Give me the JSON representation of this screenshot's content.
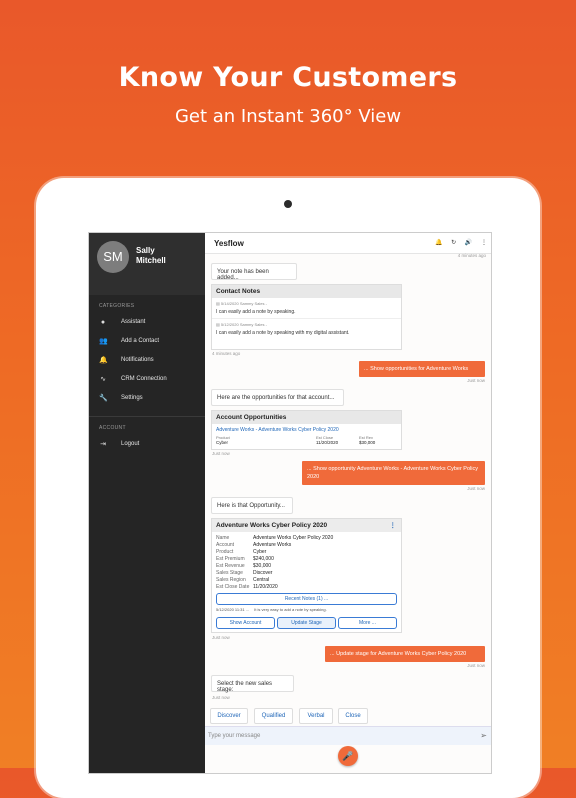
{
  "promo": {
    "headline": "Know Your Customers",
    "subline": "Get an Instant 360° View"
  },
  "colors": {
    "accent": "#f06a3a",
    "sidebar": "#252525",
    "link": "#1f66b8"
  },
  "sidebar": {
    "avatar": "SM",
    "user_name": "Sally\nMitchell",
    "categories_label": "CATEGORIES",
    "items": [
      {
        "label": "Assistant",
        "icon": "chat-icon"
      },
      {
        "label": "Add a Contact",
        "icon": "add-user-icon"
      },
      {
        "label": "Notifications",
        "icon": "bell-icon"
      },
      {
        "label": "CRM Connection",
        "icon": "pulse-icon"
      },
      {
        "label": "Settings",
        "icon": "wrench-icon"
      }
    ],
    "account_label": "ACCOUNT",
    "logout": {
      "label": "Logout",
      "icon": "logout-icon"
    }
  },
  "topbar": {
    "title": "Yesflow",
    "icons": [
      "bell-icon",
      "refresh-icon",
      "volume-icon",
      "more-vertical-icon"
    ]
  },
  "chat": {
    "top_ts": "4 minutes ago",
    "note_added": "Your note has been added...",
    "contact_notes": {
      "title": "Contact Notes",
      "notes": [
        {
          "meta": "5/14/2020  Sammy Sales -",
          "text": "I can easily add a note by speaking."
        },
        {
          "meta": "5/12/2020  Sammy Sales -",
          "text": "I can easily add a note by speaking with my digital assistant."
        }
      ],
      "ts": "4 minutes ago"
    },
    "user_msg_1": "... Show opportunities for Adventure Works",
    "user_ts_1": "Just now",
    "opps_intro": "Here are the opportunities for that account...",
    "account_opps": {
      "title": "Account Opportunities",
      "link": "Adventure Works - Adventure Works Cyber Policy 2020",
      "headers": [
        "Product",
        "Est Close",
        "Est Rev"
      ],
      "values": [
        "Cyber",
        "11/20/2020",
        "$30,000"
      ],
      "ts": "Just now"
    },
    "user_msg_2": "... Show opportunity Adventure Works - Adventure Works Cyber Policy 2020",
    "user_ts_2": "Just now",
    "opp_intro": "Here is that Opportunity...",
    "opportunity": {
      "title": "Adventure Works Cyber Policy 2020",
      "fields": [
        {
          "k": "Name",
          "v": "Adventure Works Cyber Policy 2020"
        },
        {
          "k": "Account",
          "v": "Adventure Works"
        },
        {
          "k": "Product",
          "v": "Cyber"
        },
        {
          "k": "Est Premium",
          "v": "$240,000"
        },
        {
          "k": "Est Revenue",
          "v": "$30,000"
        },
        {
          "k": "Sales Stage",
          "v": "Discover"
        },
        {
          "k": "Sales Region",
          "v": "Central"
        },
        {
          "k": "Est Close Date",
          "v": "11/20/2020"
        }
      ],
      "recent_notes": "Recent Notes (1) ...",
      "note_meta": "5/12/2020 11:31 ...",
      "note_text": "It is very easy to add a note by speaking.",
      "buttons": [
        "Show Account",
        "Update Stage",
        "More ..."
      ],
      "ts": "Just now"
    },
    "user_msg_3": "... Update stage for Adventure Works Cyber Policy 2020",
    "user_ts_3": "Just now",
    "stage_prompt": "Select the new sales stage:",
    "stage_ts": "Just now",
    "choices": [
      "Discover",
      "Qualified",
      "Verbal",
      "Close"
    ]
  },
  "input": {
    "placeholder": "Type your message"
  }
}
